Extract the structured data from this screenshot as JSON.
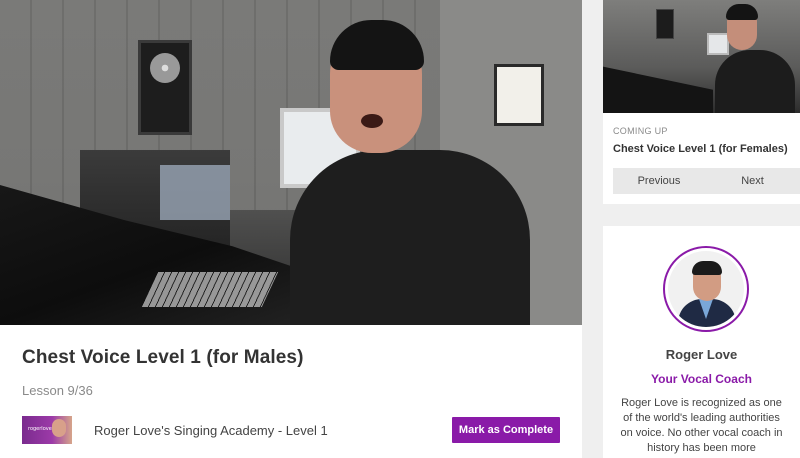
{
  "video": {
    "subject": "Roger Love speaking in a recording studio"
  },
  "lesson": {
    "title": "Chest Voice Level 1 (for Males)",
    "count": "Lesson 9/36"
  },
  "course": {
    "name": "Roger Love's Singing Academy - Level 1",
    "thumb_text": "rogerlove"
  },
  "actions": {
    "mark_complete": "Mark as Complete"
  },
  "up_next": {
    "label": "COMING UP",
    "title": "Chest Voice Level 1 (for Females)",
    "previous": "Previous",
    "next": "Next"
  },
  "coach": {
    "name": "Roger Love",
    "role": "Your Vocal Coach",
    "bio": "Roger Love is recognized as one of the world's leading authorities on voice. No other vocal coach in history has been more"
  },
  "colors": {
    "accent": "#8a1aa8",
    "background": "#efefef"
  }
}
